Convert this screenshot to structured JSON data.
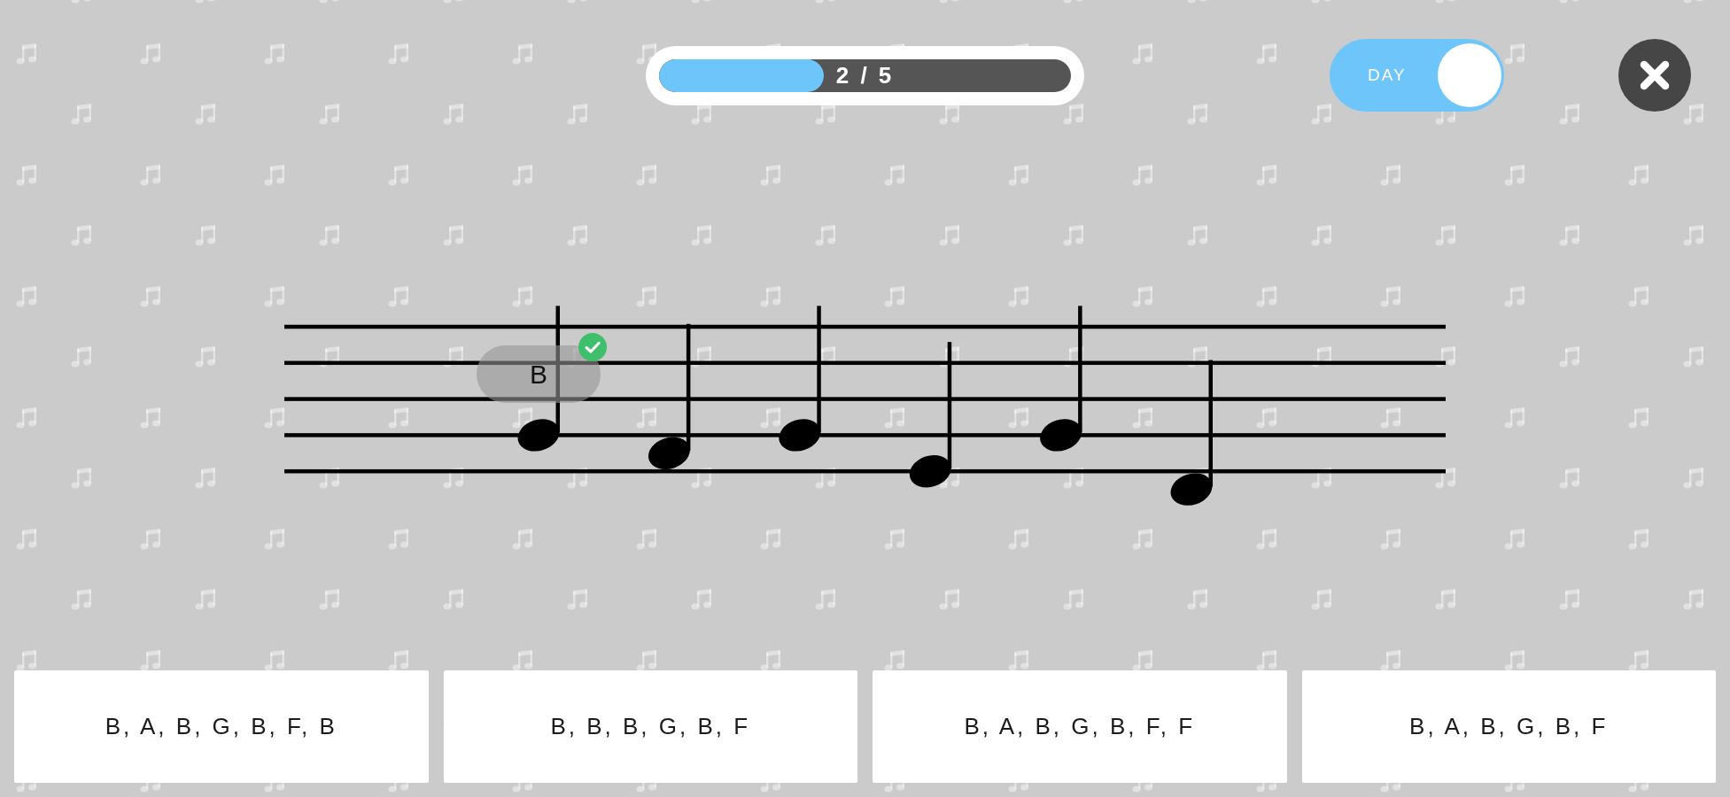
{
  "progress": {
    "level": 0.4,
    "text": "2 / 5"
  },
  "theme_toggle": {
    "label": "DAY",
    "on": true
  },
  "staff": {
    "notes": [
      {
        "kind": "line4",
        "feedback": {
          "label": "B",
          "correct": true
        }
      },
      {
        "kind": "space4"
      },
      {
        "kind": "line4"
      },
      {
        "kind": "line5"
      },
      {
        "kind": "line4"
      },
      {
        "kind": "space5"
      }
    ]
  },
  "answers": [
    "B, A, B, G, B, F, B",
    "B, B, B, G, B, F",
    "B, A, B, G, B, F, F",
    "B, A, B, G, B, F"
  ]
}
